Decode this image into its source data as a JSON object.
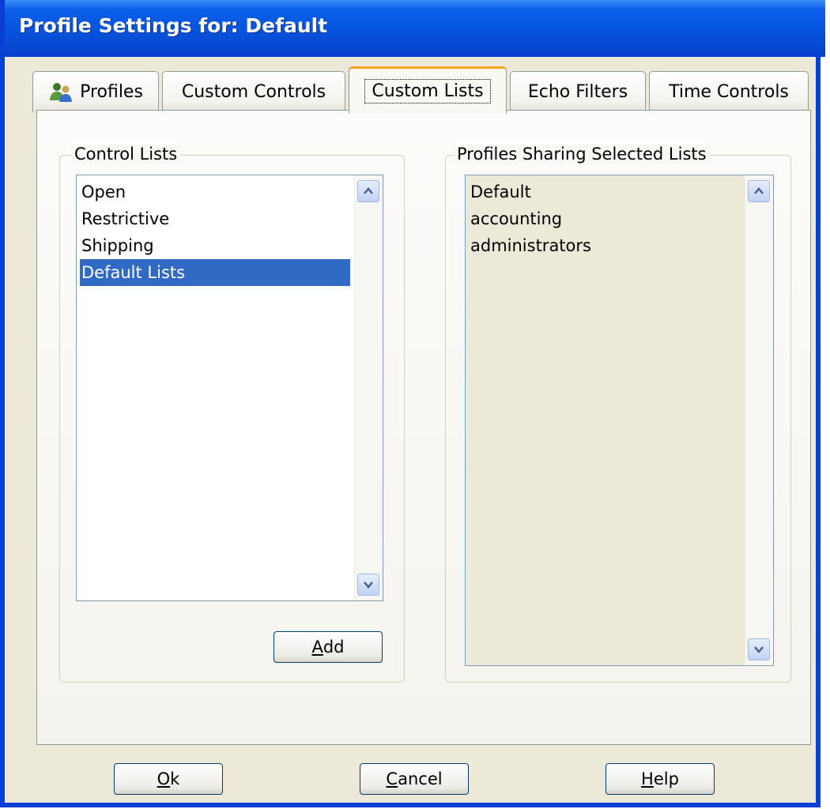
{
  "window": {
    "title": "Profile Settings for: Default"
  },
  "tabs": [
    {
      "label": "Profiles",
      "icon": "profiles-icon"
    },
    {
      "label": "Custom Controls"
    },
    {
      "label": "Custom Lists",
      "active": true
    },
    {
      "label": "Echo Filters"
    },
    {
      "label": "Time Controls"
    }
  ],
  "control_lists": {
    "legend": "Control Lists",
    "items": [
      "Open",
      "Restrictive",
      "Shipping",
      "Default Lists"
    ],
    "selected": "Default Lists",
    "add_button": {
      "mnemonic": "A",
      "rest": "dd"
    }
  },
  "profiles_sharing": {
    "legend": "Profiles Sharing Selected Lists",
    "items": [
      "Default",
      "accounting",
      "administrators"
    ]
  },
  "buttons": {
    "ok": {
      "mnemonic": "O",
      "rest": "k"
    },
    "cancel": {
      "mnemonic": "C",
      "rest": "ancel"
    },
    "help": {
      "mnemonic": "H",
      "rest": "elp"
    }
  },
  "colors": {
    "titlebar": "#0654df",
    "selection": "#316ac5",
    "dialog_bg": "#ece9d8",
    "active_tab_accent": "#f5a31c"
  }
}
